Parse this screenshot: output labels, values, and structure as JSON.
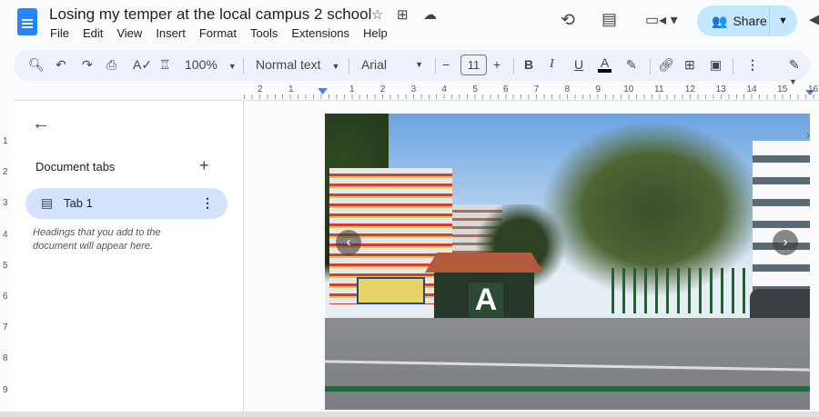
{
  "doc_title": "Losing my temper at the local campus 2 school",
  "menu": [
    "File",
    "Edit",
    "View",
    "Insert",
    "Format",
    "Tools",
    "Extensions",
    "Help"
  ],
  "share_label": "Share",
  "toolbar": {
    "zoom": "100%",
    "style": "Normal text",
    "font": "Arial",
    "font_size": "11"
  },
  "ruler_left": [
    "2",
    "1"
  ],
  "ruler_right": [
    "1",
    "2",
    "3",
    "4",
    "5",
    "6",
    "7",
    "8",
    "9",
    "10",
    "11",
    "12",
    "13",
    "14",
    "15",
    "16"
  ],
  "vruler": [
    "1",
    "2",
    "3",
    "4",
    "5",
    "6",
    "7",
    "8",
    "9"
  ],
  "sidebar": {
    "heading": "Document tabs",
    "tab": "Tab 1",
    "hint": "Headings that you add to the document will appear here."
  },
  "photo": {
    "gate_letter": "A"
  },
  "colors": {
    "accent": "#0b57d0",
    "share_bg": "#c2e7ff",
    "toolbar_bg": "#edf2fa",
    "tab_selected": "#d3e3fd"
  }
}
